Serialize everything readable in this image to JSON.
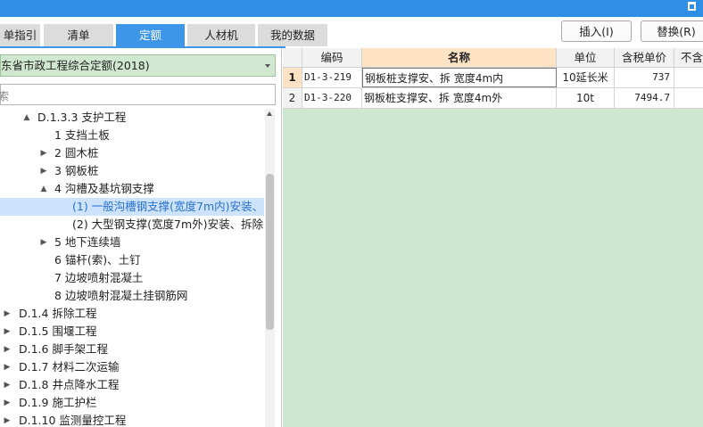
{
  "tabs": [
    {
      "label": "单指引",
      "active": false
    },
    {
      "label": "清单",
      "active": false
    },
    {
      "label": "定额",
      "active": true
    },
    {
      "label": "人材机",
      "active": false
    },
    {
      "label": "我的数据",
      "active": false
    }
  ],
  "buttons": {
    "insert": "插入(I)",
    "replace": "替换(R)"
  },
  "quota_library": {
    "selected": "东省市政工程综合定额(2018)"
  },
  "search": {
    "placeholder": "索"
  },
  "tree": [
    {
      "label": "D.1.3.3 支护工程",
      "toggle": "▲",
      "selected": false
    },
    {
      "label": "1 支挡土板",
      "toggle": "",
      "selected": false
    },
    {
      "label": "2 圆木桩",
      "toggle": "▶",
      "selected": false
    },
    {
      "label": "3 钢板桩",
      "toggle": "▶",
      "selected": false
    },
    {
      "label": "4 沟槽及基坑钢支撑",
      "toggle": "▲",
      "selected": false
    },
    {
      "label": "(1) 一般沟槽钢支撑(宽度7m内)安装、...",
      "toggle": "",
      "selected": true
    },
    {
      "label": "(2) 大型钢支撑(宽度7m外)安装、拆除",
      "toggle": "",
      "selected": false
    },
    {
      "label": "5 地下连续墙",
      "toggle": "▶",
      "selected": false
    },
    {
      "label": "6 锚杆(索)、土钉",
      "toggle": "",
      "selected": false
    },
    {
      "label": "7 边坡喷射混凝土",
      "toggle": "",
      "selected": false
    },
    {
      "label": "8 边坡喷射混凝土挂钢筋网",
      "toggle": "",
      "selected": false
    },
    {
      "label": "D.1.4 拆除工程",
      "toggle": "▶",
      "selected": false
    },
    {
      "label": "D.1.5 围堰工程",
      "toggle": "▶",
      "selected": false
    },
    {
      "label": "D.1.6 脚手架工程",
      "toggle": "▶",
      "selected": false
    },
    {
      "label": "D.1.7 材料二次运输",
      "toggle": "▶",
      "selected": false
    },
    {
      "label": "D.1.8 井点降水工程",
      "toggle": "▶",
      "selected": false
    },
    {
      "label": "D.1.9 施工护栏",
      "toggle": "▶",
      "selected": false
    },
    {
      "label": "D.1.10 监测量控工程",
      "toggle": "▶",
      "selected": false
    }
  ],
  "grid": {
    "columns": [
      "",
      "编码",
      "名称",
      "单位",
      "含税单价",
      "不含"
    ],
    "rows": [
      {
        "num": "1",
        "code": "D1-3-219",
        "name": "钢板桩支撑安、拆 宽度4m内",
        "unit": "10延长米",
        "price": "737",
        "extra": ""
      },
      {
        "num": "2",
        "code": "D1-3-220",
        "name": "钢板桩支撑安、拆 宽度4m外",
        "unit": "10t",
        "price": "7494.7",
        "extra": ""
      }
    ]
  },
  "colors": {
    "accent": "#3d96e8",
    "grid_bg": "#cde7d0",
    "selected_row": "#cce3fb"
  }
}
